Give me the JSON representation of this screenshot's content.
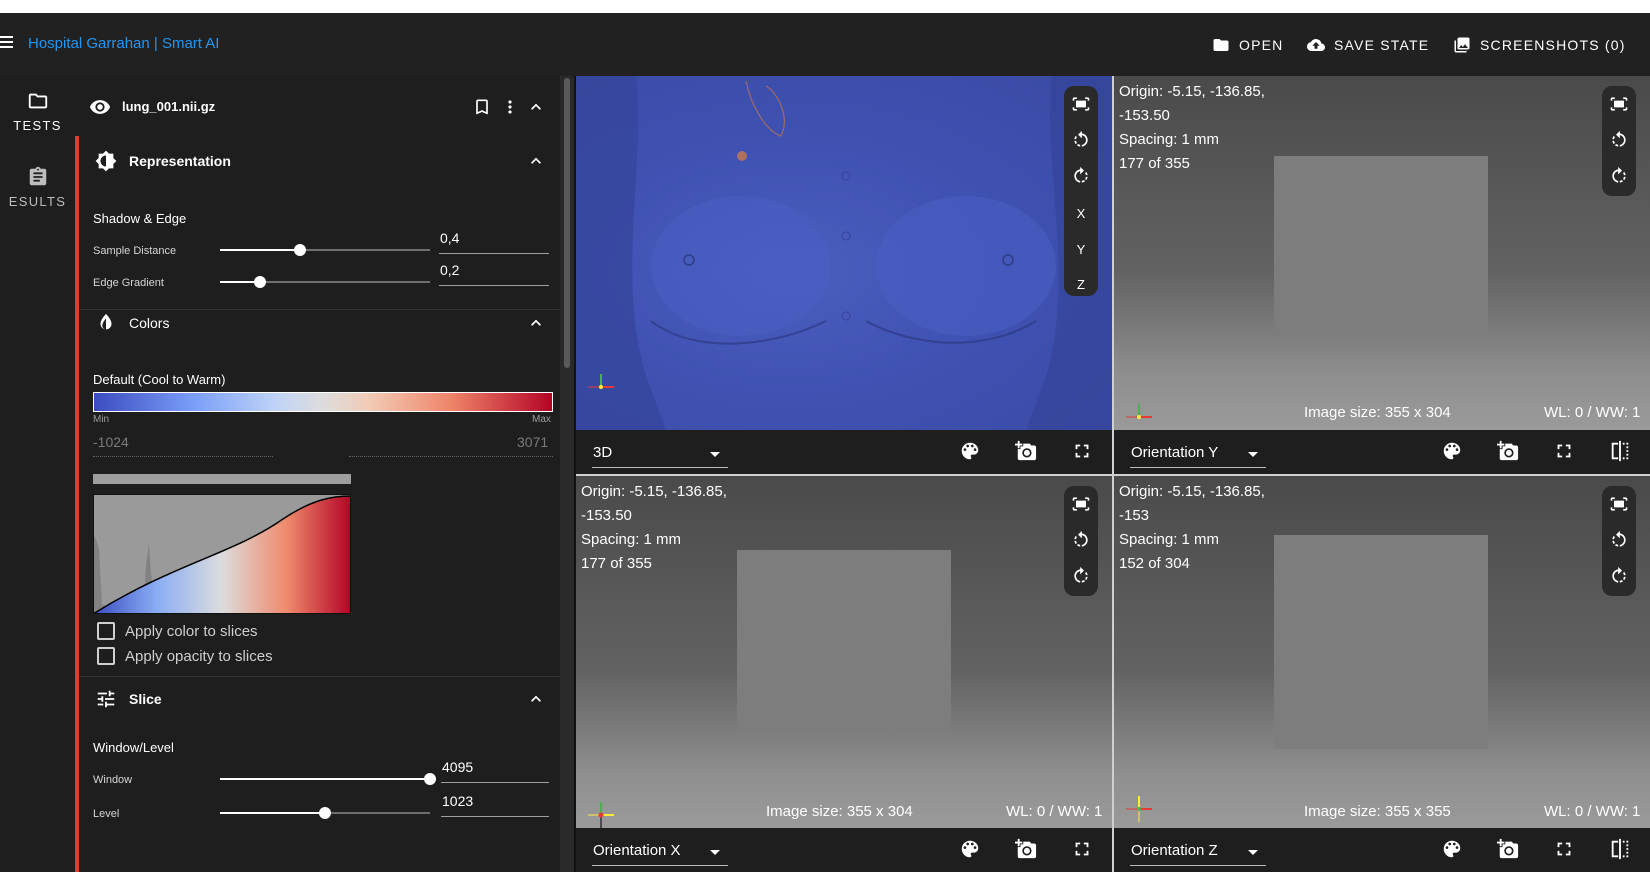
{
  "app": {
    "brand": "Hospital Garrahan | Smart AI",
    "actions": {
      "open": "OPEN",
      "save_state": "SAVE STATE",
      "screenshots": "SCREENSHOTS (0)"
    }
  },
  "rail": {
    "tests": "TESTS",
    "results": "ESULTS"
  },
  "panel": {
    "file_name": "lung_001.nii.gz",
    "representation": {
      "title": "Representation",
      "subtitle": "Shadow & Edge",
      "sample_distance": {
        "label": "Sample Distance",
        "value": "0,4",
        "fraction": 0.38
      },
      "edge_gradient": {
        "label": "Edge Gradient",
        "value": "0,2",
        "fraction": 0.19
      }
    },
    "colors": {
      "title": "Colors",
      "colormap": "Default (Cool to Warm)",
      "min_label": "Min",
      "max_label": "Max",
      "min_value": "-1024",
      "max_value": "3071",
      "apply_color": "Apply color to slices",
      "apply_opacity": "Apply opacity to slices"
    },
    "slice": {
      "title": "Slice",
      "subtitle": "Window/Level",
      "window": {
        "label": "Window",
        "value": "4095",
        "fraction": 1.0
      },
      "level": {
        "label": "Level",
        "value": "1023",
        "fraction": 0.5
      }
    }
  },
  "views": {
    "v3d": {
      "selector": "3D",
      "tools": {
        "x": "X",
        "y": "Y",
        "z": "Z"
      }
    },
    "vy": {
      "selector": "Orientation Y",
      "origin1": "Origin: -5.15, -136.85,",
      "origin2": "-153.50",
      "spacing": "Spacing: 1 mm",
      "index": "177 of 355",
      "image_size": "Image size: 355 x 304",
      "wl": "WL: 0 / WW: 1"
    },
    "vx": {
      "selector": "Orientation X",
      "origin1": "Origin: -5.15, -136.85,",
      "origin2": "-153.50",
      "spacing": "Spacing: 1 mm",
      "index": "177 of 355",
      "image_size": "Image size: 355 x 304",
      "wl": "WL: 0 / WW: 1"
    },
    "vz": {
      "selector": "Orientation Z",
      "origin1": "Origin: -5.15, -136.85,",
      "origin2": "-153",
      "spacing": "Spacing: 1 mm",
      "index": "152 of 304",
      "image_size": "Image size: 355 x 355",
      "wl": "WL: 0 / WW: 1"
    }
  },
  "colors": {
    "accent_blue": "#2196f3",
    "accent_red": "#e53935",
    "volume_blue": "#3f52b3"
  }
}
